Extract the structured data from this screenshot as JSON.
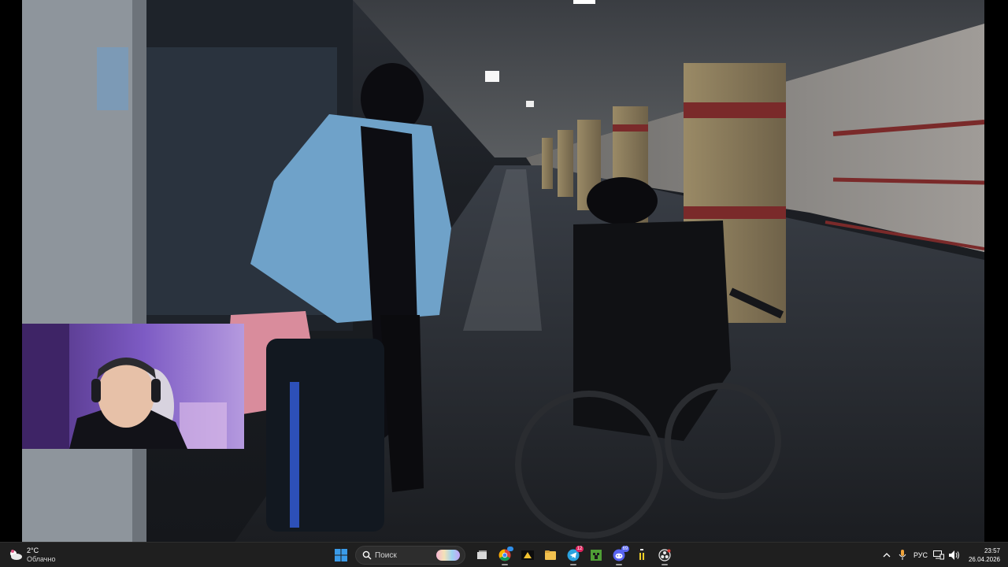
{
  "taskbar": {
    "weather": {
      "temperature": "2°C",
      "condition": "Облачно",
      "icon": "cloud-icon"
    },
    "search_placeholder": "Поиск",
    "start_icon": "windows-start-icon",
    "pinned_apps": [
      {
        "name": "task-view-icon"
      },
      {
        "name": "chrome-icon",
        "badge": ""
      },
      {
        "name": "media-player-icon"
      },
      {
        "name": "file-explorer-icon"
      },
      {
        "name": "telegram-icon",
        "badge": "12"
      },
      {
        "name": "minecraft-icon"
      },
      {
        "name": "discord-icon",
        "badge": "69"
      },
      {
        "name": "battery-app-icon"
      },
      {
        "name": "obs-icon"
      }
    ],
    "tray": {
      "chevron_icon": "chevron-up-icon",
      "mic_icon": "microphone-icon",
      "language": "РУС",
      "network_icon": "network-icon",
      "volume_icon": "volume-icon"
    },
    "clock": {
      "time": "23:57",
      "date": "26.04.2026"
    }
  },
  "colors": {
    "taskbar_bg": "#1f1f1f",
    "windows_blue": "#2f8fea",
    "telegram_badge": "#e0245e",
    "discord_badge": "#5865f2"
  }
}
